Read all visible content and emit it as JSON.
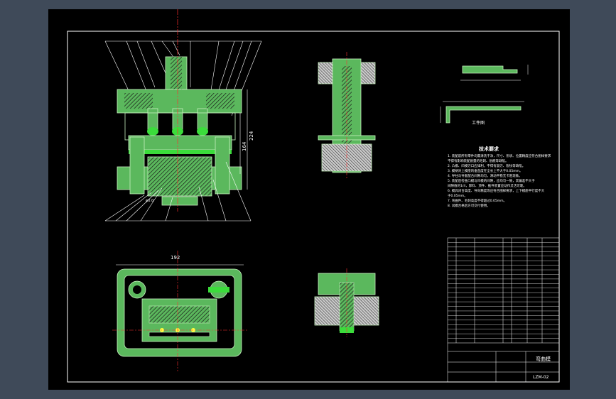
{
  "colors": {
    "background_frame": "#3f4a59",
    "canvas": "#000000",
    "part_fill": "#5bb85d",
    "part_stroke": "#c8f0c0",
    "centerline": "#ff3030",
    "leader": "#ffffff",
    "hatch": "#d8d8d8"
  },
  "main_view": {
    "dim_height": "224",
    "dim_inner": "164",
    "dim_bottom": "φ0.0"
  },
  "top_view": {
    "dim_width": "192"
  },
  "workpiece": {
    "label": "工件图"
  },
  "tech_requirements": {
    "title": "技术要求",
    "items": [
      "1. 装配前所有零件均需清洗干净，尺寸、形状、位置精度应符合图样要求",
      "   不得有影响装配质量的毛刺、划痕等缺陷。",
      "2. 凸模、凹模刃口应锋利，不得有崩刃、裂纹等缺陷。",
      "3. 模柄对上模座的垂直度在全长上不大于0.05mm。",
      "4. 导柱与导套配合间隙均匀，滑动平稳无卡阻现象。",
      "5. 装配后检查凸模与凹模的间隙，应均匀一致，其偏差不大于",
      "   间隙值的1/4，卸料、顶件、推件装置应动作灵活可靠。",
      "6. 模具闭合高度、导向精度等应符合图样要求，上下模座平行度不大",
      "   于0.05mm。",
      "7. 弯曲件、毛刺高度不得超过0.05mm。",
      "8. 试模合格后方可交付使用。"
    ]
  },
  "title_block": {
    "drawing_name": "弯曲模",
    "drawing_number": "LZM-02"
  }
}
